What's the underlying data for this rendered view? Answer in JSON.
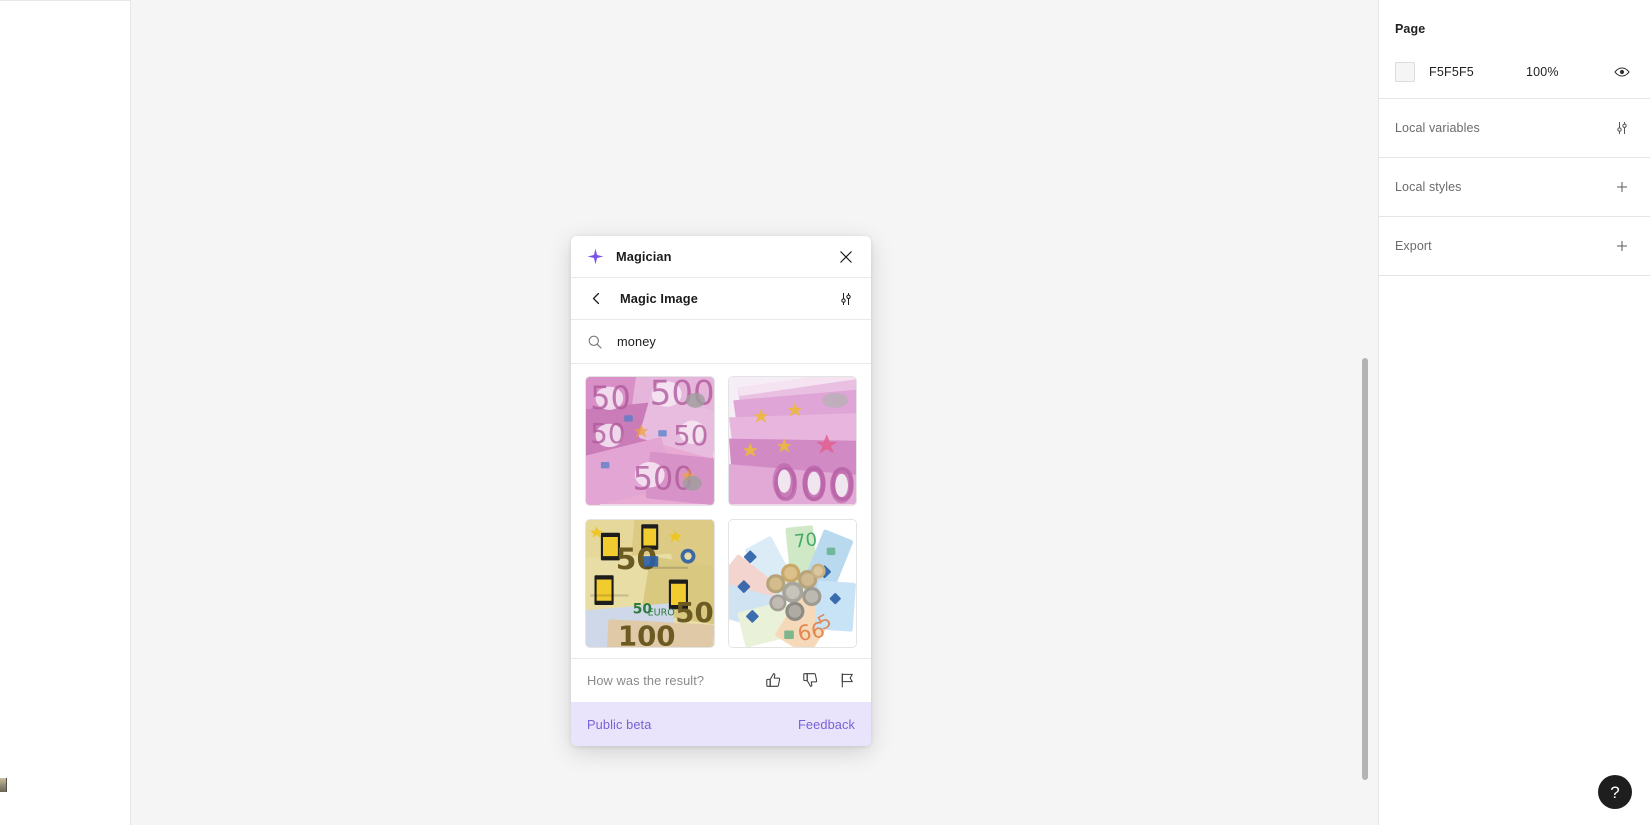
{
  "right_panel": {
    "page_section": {
      "title": "Page",
      "color_hex": "F5F5F5",
      "opacity": "100%",
      "visibility_icon": "eye-icon"
    },
    "rows": [
      {
        "label": "Local variables",
        "action_icon": "sliders-icon"
      },
      {
        "label": "Local styles",
        "action_icon": "plus-icon"
      },
      {
        "label": "Export",
        "action_icon": "plus-icon"
      }
    ]
  },
  "help": {
    "label": "?"
  },
  "modal": {
    "header": {
      "title": "Magician",
      "icon": "sparkle-icon",
      "close_icon": "close-icon"
    },
    "subbar": {
      "title": "Magic Image",
      "back_icon": "chevron-left-icon",
      "settings_icon": "sliders-icon"
    },
    "search": {
      "value": "money",
      "placeholder": "Search",
      "icon": "search-icon"
    },
    "results": [
      {
        "alt": "Pile of purple 500 and 50 euro banknotes",
        "index": 1
      },
      {
        "alt": "Fanned purple 500 euro banknotes close up",
        "index": 2
      },
      {
        "alt": "Yellow 50 euro and 100 euro banknotes",
        "index": 3
      },
      {
        "alt": "Fan of colourful euro banknotes with coins",
        "index": 4
      }
    ],
    "feedback": {
      "prompt": "How was the result?",
      "thumbs_up_icon": "thumbs-up-icon",
      "thumbs_down_icon": "thumbs-down-icon",
      "flag_icon": "flag-icon"
    },
    "beta": {
      "label": "Public beta",
      "link": "Feedback"
    }
  },
  "colors": {
    "accent_purple": "#7b61d8",
    "beta_bar_bg": "#e9e4fb",
    "canvas_bg": "#f5f5f5",
    "panel_bg": "#ffffff"
  }
}
